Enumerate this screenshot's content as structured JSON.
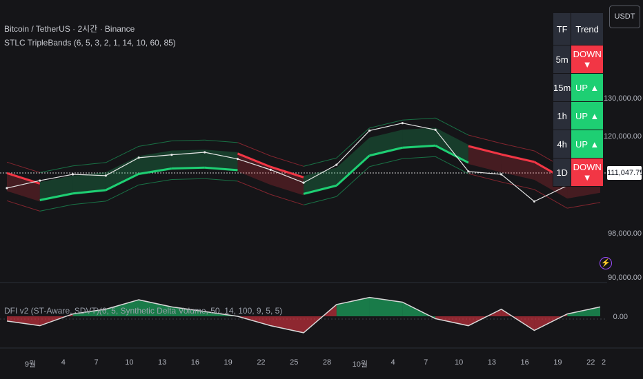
{
  "header": {
    "symbol_line": "Bitcoin / TetherUS · 2시간 · Binance",
    "indicator_line": "STLC TripleBands (6, 5, 3, 2, 1, 14, 10, 60, 85)",
    "lower_indicator_line": "DFI v2 (ST-Aware, SDVT)(6, 5, Synthetic Delta Volume, 50, 14, 100, 9, 5, 5)",
    "currency": "USDT"
  },
  "price_axis": {
    "labels": [
      "130,000.00",
      "120,000.00",
      "98,000.00",
      "90,000.00"
    ],
    "current_price": "111,047.75",
    "lower_pane_zero": "0.00"
  },
  "trend_table": {
    "header": [
      "TF",
      "Trend"
    ],
    "rows": [
      {
        "tf": "5m",
        "trend": "DOWN ▼",
        "state": "down"
      },
      {
        "tf": "15m",
        "trend": "UP ▲",
        "state": "up"
      },
      {
        "tf": "1h",
        "trend": "UP ▲",
        "state": "up"
      },
      {
        "tf": "4h",
        "trend": "UP ▲",
        "state": "up"
      },
      {
        "tf": "1D",
        "trend": "DOWN ▼",
        "state": "down"
      }
    ]
  },
  "time_axis": [
    "9월",
    "4",
    "7",
    "10",
    "13",
    "16",
    "19",
    "22",
    "25",
    "28",
    "10월",
    "4",
    "7",
    "10",
    "13",
    "16",
    "19",
    "22",
    "2"
  ],
  "colors": {
    "up": "#1ecf73",
    "down": "#f23645",
    "price": "#e6e6e6",
    "background": "#151518"
  },
  "chart_data": [
    {
      "type": "line",
      "title": "",
      "x": [
        "9월",
        "4",
        "7",
        "10",
        "13",
        "16",
        "19",
        "22",
        "25",
        "28",
        "10월",
        "4",
        "7",
        "10",
        "13",
        "16",
        "19",
        "22",
        "2"
      ],
      "ylim": [
        88000,
        136000
      ],
      "series": [
        {
          "values": [
            108200,
            110000,
            111500,
            111200,
            115500,
            116200,
            116800,
            115200,
            112600,
            109500,
            113800,
            122000,
            123800,
            122200,
            112200,
            111500,
            105000,
            108800,
            110600
          ]
        }
      ],
      "bands": {
        "mid_values": [
          109800,
          107300,
          108900,
          109700,
          113600,
          114900,
          115100,
          114500,
          111300,
          108800,
          110800,
          118000,
          119900,
          120400,
          116300,
          114300,
          112500,
          108000,
          109400
        ],
        "state": [
          "down",
          "up",
          "up",
          "up",
          "up",
          "up",
          "up",
          "down",
          "down",
          "up",
          "up",
          "up",
          "up",
          "up",
          "down",
          "down",
          "down",
          "down",
          "up"
        ]
      }
    },
    {
      "type": "area",
      "title": "",
      "x": [
        "9월",
        "4",
        "7",
        "10",
        "13",
        "16",
        "19",
        "22",
        "25",
        "28",
        "10월",
        "4",
        "7",
        "10",
        "13",
        "16",
        "19",
        "22",
        "2"
      ],
      "ylim": [
        -60,
        60
      ],
      "series": [
        {
          "values": [
            -10,
            -20,
            5,
            15,
            35,
            20,
            10,
            0,
            -20,
            -35,
            25,
            40,
            30,
            -5,
            -20,
            15,
            -30,
            5,
            20
          ]
        }
      ]
    }
  ]
}
